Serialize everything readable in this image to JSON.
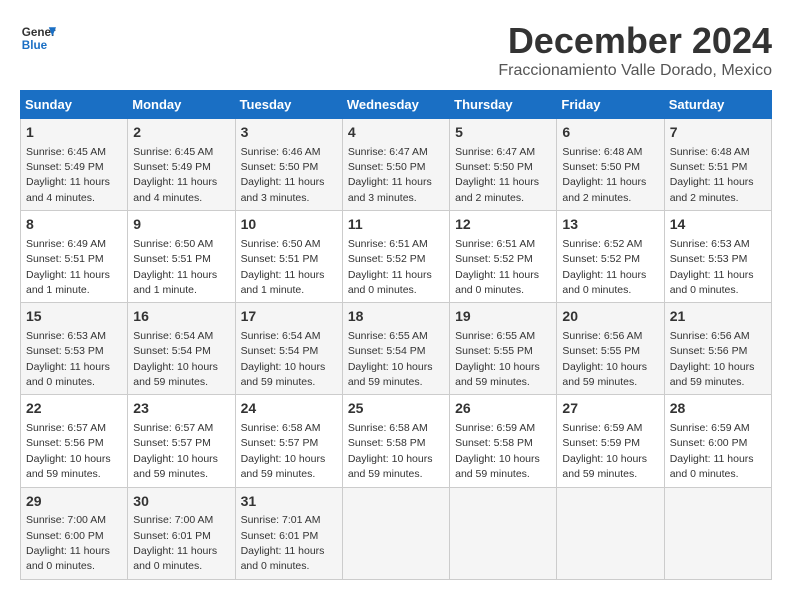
{
  "header": {
    "logo_line1": "General",
    "logo_line2": "Blue",
    "month": "December 2024",
    "location": "Fraccionamiento Valle Dorado, Mexico"
  },
  "weekdays": [
    "Sunday",
    "Monday",
    "Tuesday",
    "Wednesday",
    "Thursday",
    "Friday",
    "Saturday"
  ],
  "weeks": [
    [
      {
        "day": "1",
        "sunrise": "6:45 AM",
        "sunset": "5:49 PM",
        "daylight": "11 hours and 4 minutes."
      },
      {
        "day": "2",
        "sunrise": "6:45 AM",
        "sunset": "5:49 PM",
        "daylight": "11 hours and 4 minutes."
      },
      {
        "day": "3",
        "sunrise": "6:46 AM",
        "sunset": "5:50 PM",
        "daylight": "11 hours and 3 minutes."
      },
      {
        "day": "4",
        "sunrise": "6:47 AM",
        "sunset": "5:50 PM",
        "daylight": "11 hours and 3 minutes."
      },
      {
        "day": "5",
        "sunrise": "6:47 AM",
        "sunset": "5:50 PM",
        "daylight": "11 hours and 2 minutes."
      },
      {
        "day": "6",
        "sunrise": "6:48 AM",
        "sunset": "5:50 PM",
        "daylight": "11 hours and 2 minutes."
      },
      {
        "day": "7",
        "sunrise": "6:48 AM",
        "sunset": "5:51 PM",
        "daylight": "11 hours and 2 minutes."
      }
    ],
    [
      {
        "day": "8",
        "sunrise": "6:49 AM",
        "sunset": "5:51 PM",
        "daylight": "11 hours and 1 minute."
      },
      {
        "day": "9",
        "sunrise": "6:50 AM",
        "sunset": "5:51 PM",
        "daylight": "11 hours and 1 minute."
      },
      {
        "day": "10",
        "sunrise": "6:50 AM",
        "sunset": "5:51 PM",
        "daylight": "11 hours and 1 minute."
      },
      {
        "day": "11",
        "sunrise": "6:51 AM",
        "sunset": "5:52 PM",
        "daylight": "11 hours and 0 minutes."
      },
      {
        "day": "12",
        "sunrise": "6:51 AM",
        "sunset": "5:52 PM",
        "daylight": "11 hours and 0 minutes."
      },
      {
        "day": "13",
        "sunrise": "6:52 AM",
        "sunset": "5:52 PM",
        "daylight": "11 hours and 0 minutes."
      },
      {
        "day": "14",
        "sunrise": "6:53 AM",
        "sunset": "5:53 PM",
        "daylight": "11 hours and 0 minutes."
      }
    ],
    [
      {
        "day": "15",
        "sunrise": "6:53 AM",
        "sunset": "5:53 PM",
        "daylight": "11 hours and 0 minutes."
      },
      {
        "day": "16",
        "sunrise": "6:54 AM",
        "sunset": "5:54 PM",
        "daylight": "10 hours and 59 minutes."
      },
      {
        "day": "17",
        "sunrise": "6:54 AM",
        "sunset": "5:54 PM",
        "daylight": "10 hours and 59 minutes."
      },
      {
        "day": "18",
        "sunrise": "6:55 AM",
        "sunset": "5:54 PM",
        "daylight": "10 hours and 59 minutes."
      },
      {
        "day": "19",
        "sunrise": "6:55 AM",
        "sunset": "5:55 PM",
        "daylight": "10 hours and 59 minutes."
      },
      {
        "day": "20",
        "sunrise": "6:56 AM",
        "sunset": "5:55 PM",
        "daylight": "10 hours and 59 minutes."
      },
      {
        "day": "21",
        "sunrise": "6:56 AM",
        "sunset": "5:56 PM",
        "daylight": "10 hours and 59 minutes."
      }
    ],
    [
      {
        "day": "22",
        "sunrise": "6:57 AM",
        "sunset": "5:56 PM",
        "daylight": "10 hours and 59 minutes."
      },
      {
        "day": "23",
        "sunrise": "6:57 AM",
        "sunset": "5:57 PM",
        "daylight": "10 hours and 59 minutes."
      },
      {
        "day": "24",
        "sunrise": "6:58 AM",
        "sunset": "5:57 PM",
        "daylight": "10 hours and 59 minutes."
      },
      {
        "day": "25",
        "sunrise": "6:58 AM",
        "sunset": "5:58 PM",
        "daylight": "10 hours and 59 minutes."
      },
      {
        "day": "26",
        "sunrise": "6:59 AM",
        "sunset": "5:58 PM",
        "daylight": "10 hours and 59 minutes."
      },
      {
        "day": "27",
        "sunrise": "6:59 AM",
        "sunset": "5:59 PM",
        "daylight": "10 hours and 59 minutes."
      },
      {
        "day": "28",
        "sunrise": "6:59 AM",
        "sunset": "6:00 PM",
        "daylight": "11 hours and 0 minutes."
      }
    ],
    [
      {
        "day": "29",
        "sunrise": "7:00 AM",
        "sunset": "6:00 PM",
        "daylight": "11 hours and 0 minutes."
      },
      {
        "day": "30",
        "sunrise": "7:00 AM",
        "sunset": "6:01 PM",
        "daylight": "11 hours and 0 minutes."
      },
      {
        "day": "31",
        "sunrise": "7:01 AM",
        "sunset": "6:01 PM",
        "daylight": "11 hours and 0 minutes."
      },
      null,
      null,
      null,
      null
    ]
  ]
}
